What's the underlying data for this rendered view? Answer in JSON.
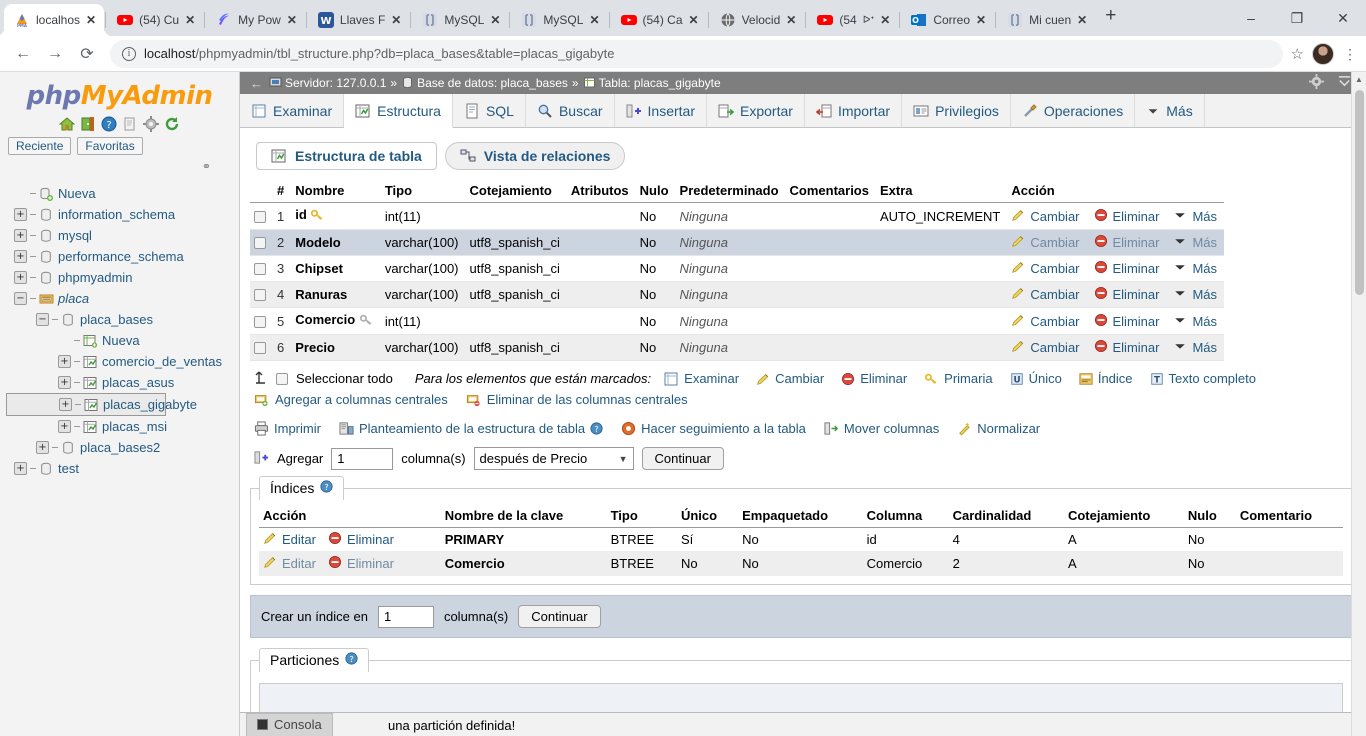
{
  "browser": {
    "tabs": [
      {
        "title": "localhos",
        "favicon": "phpmyadmin-icon",
        "active": true,
        "muted": false
      },
      {
        "title": "(54) Cu",
        "favicon": "youtube-icon",
        "active": false,
        "muted": false
      },
      {
        "title": "My Pow",
        "favicon": "powtoon-icon",
        "active": false,
        "muted": false
      },
      {
        "title": "Llaves F",
        "favicon": "word-icon",
        "active": false,
        "muted": false
      },
      {
        "title": "MySQL",
        "favicon": "mysql-icon",
        "active": false,
        "muted": false
      },
      {
        "title": "MySQL",
        "favicon": "mysql-icon",
        "active": false,
        "muted": false
      },
      {
        "title": "(54) Ca",
        "favicon": "youtube-icon",
        "active": false,
        "muted": false
      },
      {
        "title": "Velocid",
        "favicon": "globe-icon",
        "active": false,
        "muted": false
      },
      {
        "title": "(54",
        "favicon": "youtube-icon",
        "active": false,
        "muted": true
      },
      {
        "title": "Correo",
        "favicon": "outlook-icon",
        "active": false,
        "muted": false
      },
      {
        "title": "Mi cuen",
        "favicon": "mysql-icon",
        "active": false,
        "muted": false
      }
    ],
    "new_tab_label": "+",
    "close_label": "✕",
    "mute_label": "ᐅᐩ",
    "window_controls": {
      "minimize": "‒",
      "maximize": "❐",
      "close": "✕"
    },
    "back_label": "←",
    "forward_label": "→",
    "reload_label": "⟳",
    "url_host": "localhost",
    "url_path": "/phpmyadmin/tbl_structure.php?db=placa_bases&table=placas_gigabyte",
    "info_label": "i",
    "bookmark_label": "☆",
    "menu_label": "⋮"
  },
  "sidebar": {
    "logo_php": "php",
    "logo_my": "MyAdmin",
    "icons": [
      "home-icon",
      "logout-icon",
      "help-icon",
      "docs-icon",
      "settings-icon",
      "reload-icon"
    ],
    "quick_buttons": [
      "Reciente",
      "Favoritas"
    ],
    "chain_icon": "chain-icon",
    "tree": [
      {
        "label": "Nueva",
        "depth": 0,
        "toggle": "",
        "icon": "new-db-icon",
        "italic": false,
        "selected": false
      },
      {
        "label": "information_schema",
        "depth": 0,
        "toggle": "+",
        "icon": "db-icon",
        "italic": false,
        "selected": false
      },
      {
        "label": "mysql",
        "depth": 0,
        "toggle": "+",
        "icon": "db-icon",
        "italic": false,
        "selected": false
      },
      {
        "label": "performance_schema",
        "depth": 0,
        "toggle": "+",
        "icon": "db-icon",
        "italic": false,
        "selected": false
      },
      {
        "label": "phpmyadmin",
        "depth": 0,
        "toggle": "+",
        "icon": "db-icon",
        "italic": false,
        "selected": false
      },
      {
        "label": "placa",
        "depth": 0,
        "toggle": "−",
        "icon": "group-icon",
        "italic": true,
        "selected": false
      },
      {
        "label": "placa_bases",
        "depth": 1,
        "toggle": "−",
        "icon": "db-icon",
        "italic": false,
        "selected": false
      },
      {
        "label": "Nueva",
        "depth": 2,
        "toggle": "",
        "icon": "new-table-icon",
        "italic": false,
        "selected": false
      },
      {
        "label": "comercio_de_ventas",
        "depth": 2,
        "toggle": "+",
        "icon": "table-icon",
        "italic": false,
        "selected": false
      },
      {
        "label": "placas_asus",
        "depth": 2,
        "toggle": "+",
        "icon": "table-icon",
        "italic": false,
        "selected": false
      },
      {
        "label": "placas_gigabyte",
        "depth": 2,
        "toggle": "+",
        "icon": "table-icon",
        "italic": false,
        "selected": true
      },
      {
        "label": "placas_msi",
        "depth": 2,
        "toggle": "+",
        "icon": "table-icon",
        "italic": false,
        "selected": false
      },
      {
        "label": "placa_bases2",
        "depth": 1,
        "toggle": "+",
        "icon": "db-icon",
        "italic": false,
        "selected": false
      },
      {
        "label": "test",
        "depth": 0,
        "toggle": "+",
        "icon": "db-icon",
        "italic": false,
        "selected": false
      }
    ]
  },
  "breadcrumb": {
    "back_arrow": "←",
    "server_label": "Servidor: 127.0.0.1",
    "database_label": "Base de datos: placa_bases",
    "table_label": "Tabla: placas_gigabyte",
    "separator": "»",
    "settings_icon": "gear-icon",
    "collapse_icon": "collapse-icon"
  },
  "nav_tabs": [
    {
      "label": "Examinar",
      "icon": "browse-icon",
      "active": false
    },
    {
      "label": "Estructura",
      "icon": "structure-icon",
      "active": true
    },
    {
      "label": "SQL",
      "icon": "sql-icon",
      "active": false
    },
    {
      "label": "Buscar",
      "icon": "search-icon",
      "active": false
    },
    {
      "label": "Insertar",
      "icon": "insert-icon",
      "active": false
    },
    {
      "label": "Exportar",
      "icon": "export-icon",
      "active": false
    },
    {
      "label": "Importar",
      "icon": "import-icon",
      "active": false
    },
    {
      "label": "Privilegios",
      "icon": "privileges-icon",
      "active": false
    },
    {
      "label": "Operaciones",
      "icon": "operations-icon",
      "active": false
    },
    {
      "label": "Más",
      "icon": "chevron-down-icon",
      "active": false
    }
  ],
  "sub_tabs": [
    {
      "label": "Estructura de tabla",
      "icon": "structure-icon",
      "active": true
    },
    {
      "label": "Vista de relaciones",
      "icon": "relations-icon",
      "active": false
    }
  ],
  "structure_table": {
    "headers": [
      "#",
      "Nombre",
      "Tipo",
      "Cotejamiento",
      "Atributos",
      "Nulo",
      "Predeterminado",
      "Comentarios",
      "Extra",
      "Acción"
    ],
    "rows": [
      {
        "num": "1",
        "name": "id",
        "key": "primary-key-icon",
        "type": "int(11)",
        "collation": "",
        "attributes": "",
        "null": "No",
        "default": "Ninguna",
        "comments": "",
        "extra": "AUTO_INCREMENT",
        "highlight": false
      },
      {
        "num": "2",
        "name": "Modelo",
        "key": "",
        "type": "varchar(100)",
        "collation": "utf8_spanish_ci",
        "attributes": "",
        "null": "No",
        "default": "Ninguna",
        "comments": "",
        "extra": "",
        "highlight": true
      },
      {
        "num": "3",
        "name": "Chipset",
        "key": "",
        "type": "varchar(100)",
        "collation": "utf8_spanish_ci",
        "attributes": "",
        "null": "No",
        "default": "Ninguna",
        "comments": "",
        "extra": "",
        "highlight": false
      },
      {
        "num": "4",
        "name": "Ranuras",
        "key": "",
        "type": "varchar(100)",
        "collation": "utf8_spanish_ci",
        "attributes": "",
        "null": "No",
        "default": "Ninguna",
        "comments": "",
        "extra": "",
        "highlight": false
      },
      {
        "num": "5",
        "name": "Comercio",
        "key": "index-key-icon",
        "type": "int(11)",
        "collation": "",
        "attributes": "",
        "null": "No",
        "default": "Ninguna",
        "comments": "",
        "extra": "",
        "highlight": false
      },
      {
        "num": "6",
        "name": "Precio",
        "key": "",
        "type": "varchar(100)",
        "collation": "utf8_spanish_ci",
        "attributes": "",
        "null": "No",
        "default": "Ninguna",
        "comments": "",
        "extra": "",
        "highlight": false
      }
    ],
    "row_actions": {
      "change": "Cambiar",
      "drop": "Eliminar",
      "more": "Más"
    }
  },
  "check_all": {
    "arrow_icon": "select-arrow-icon",
    "label": "Seleccionar todo",
    "marked_text": "Para los elementos que están marcados:",
    "actions": [
      {
        "label": "Examinar",
        "icon": "browse-icon"
      },
      {
        "label": "Cambiar",
        "icon": "pencil-icon"
      },
      {
        "label": "Eliminar",
        "icon": "drop-icon"
      },
      {
        "label": "Primaria",
        "icon": "primary-key-icon"
      },
      {
        "label": "Único",
        "icon": "unique-icon"
      },
      {
        "label": "Índice",
        "icon": "index-icon"
      },
      {
        "label": "Texto completo",
        "icon": "fulltext-icon"
      }
    ],
    "central_actions": [
      {
        "label": "Agregar a columnas centrales",
        "icon": "add-central-icon"
      },
      {
        "label": "Eliminar de las columnas centrales",
        "icon": "remove-central-icon"
      }
    ]
  },
  "tools": [
    {
      "label": "Imprimir",
      "icon": "print-icon"
    },
    {
      "label": "Planteamiento de la estructura de tabla",
      "icon": "proposal-icon",
      "help": "help-icon"
    },
    {
      "label": "Hacer seguimiento a la tabla",
      "icon": "tracking-icon"
    },
    {
      "label": "Mover columnas",
      "icon": "move-columns-icon"
    },
    {
      "label": "Normalizar",
      "icon": "normalize-icon"
    }
  ],
  "add_column": {
    "icon": "add-column-icon",
    "label": "Agregar",
    "count_value": "1",
    "columns_label": "columna(s)",
    "position_value": "después de Precio",
    "dropdown_arrow": "▼",
    "submit_label": "Continuar"
  },
  "indexes": {
    "legend": "Índices",
    "help_icon": "help-icon",
    "headers": [
      "Acción",
      "Nombre de la clave",
      "Tipo",
      "Único",
      "Empaquetado",
      "Columna",
      "Cardinalidad",
      "Cotejamiento",
      "Nulo",
      "Comentario"
    ],
    "edit_label": "Editar",
    "drop_label": "Eliminar",
    "rows": [
      {
        "keyname": "PRIMARY",
        "type": "BTREE",
        "unique": "Sí",
        "packed": "No",
        "column": "id",
        "cardinality": "4",
        "collation": "A",
        "null": "No",
        "comment": ""
      },
      {
        "keyname": "Comercio",
        "type": "BTREE",
        "unique": "No",
        "packed": "No",
        "column": "Comercio",
        "cardinality": "2",
        "collation": "A",
        "null": "No",
        "comment": ""
      }
    ]
  },
  "create_index": {
    "label": "Crear un índice en",
    "count_value": "1",
    "columns_label": "columna(s)",
    "submit_label": "Continuar"
  },
  "partitions": {
    "legend": "Particiones",
    "help_icon": "help-icon",
    "message": "una partición definida!"
  },
  "console": {
    "label": "Consola",
    "icon": "console-icon"
  },
  "colors": {
    "pma_orange": "#f89c0e",
    "pma_blue": "#6c78af",
    "link": "#235a81",
    "header_grey": "#7e7e7e",
    "row_highlight": "#ccd4e0"
  }
}
